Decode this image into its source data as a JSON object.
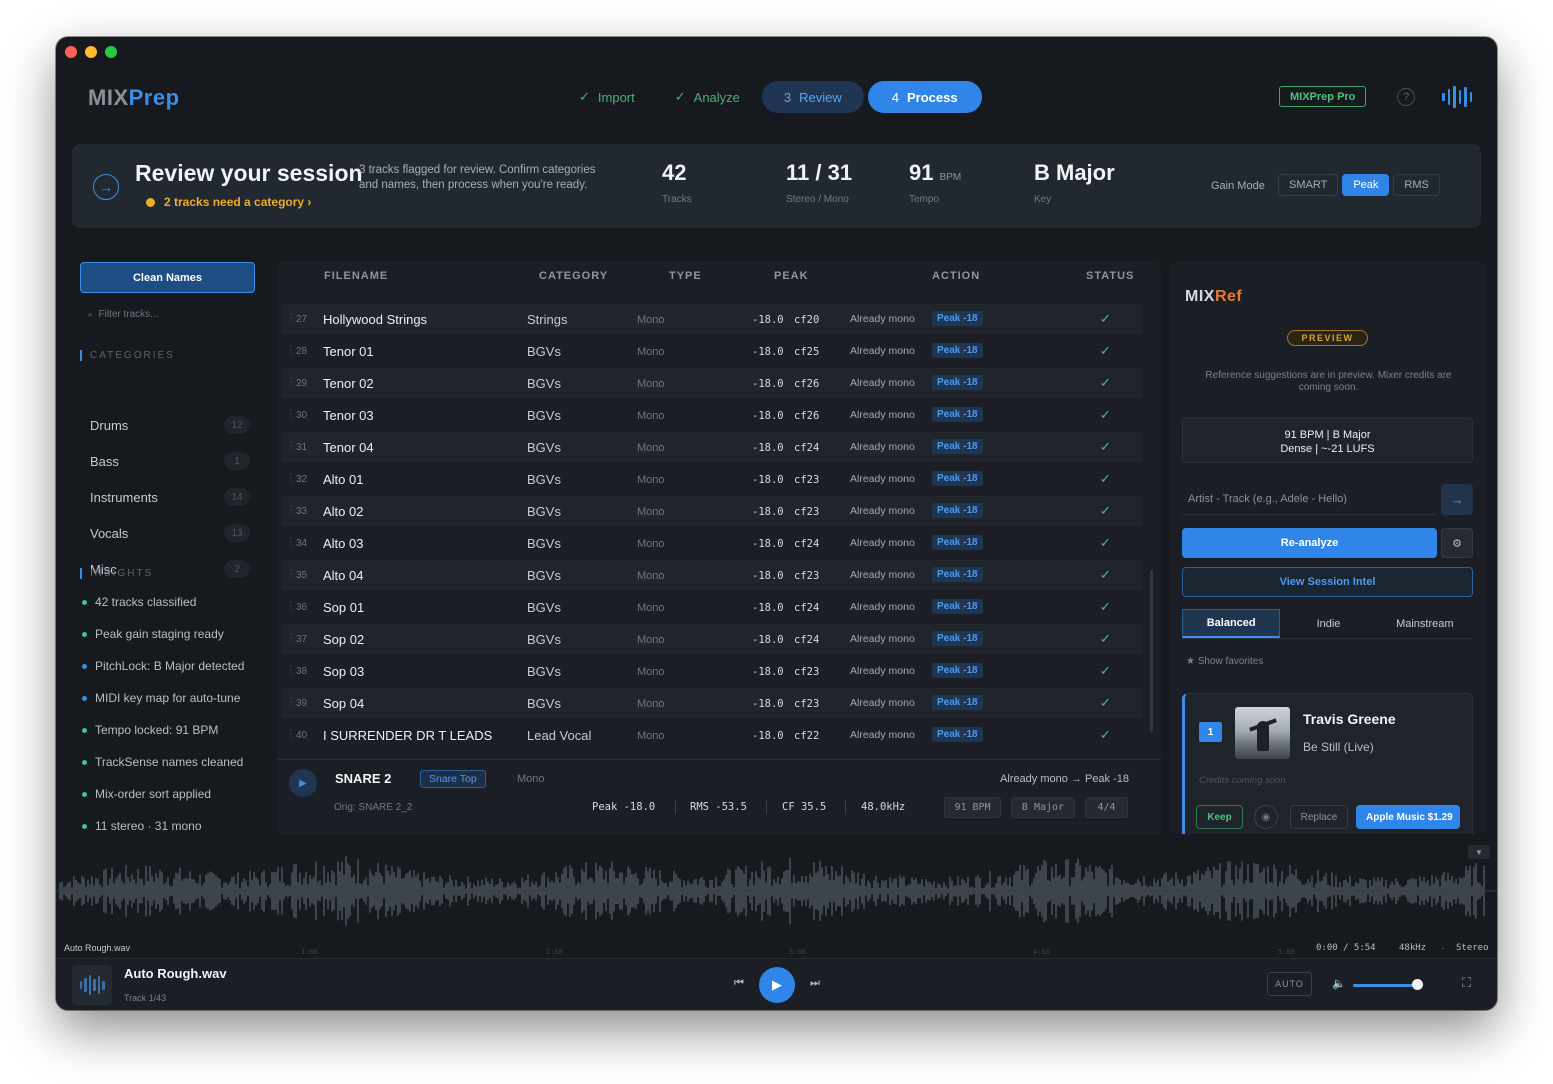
{
  "app": {
    "logo_a": "MIX",
    "logo_b": "Prep"
  },
  "steps": [
    {
      "icon": "✓",
      "label": "Import"
    },
    {
      "icon": "✓",
      "label": "Analyze"
    },
    {
      "icon": "3",
      "label": "Review"
    },
    {
      "icon": "4",
      "label": "Process"
    }
  ],
  "header": {
    "pro_label": "MIXPrep Pro",
    "help": "?"
  },
  "banner": {
    "title": "Review your session",
    "warning": "2 tracks need a category  ›",
    "description": "3 tracks flagged for review. Confirm categories and names, then process when you're ready.",
    "stats": [
      {
        "value": "42",
        "unit": "",
        "label": "Tracks"
      },
      {
        "value": "11 / 31",
        "unit": "",
        "label": "Stereo / Mono"
      },
      {
        "value": "91",
        "unit": "BPM",
        "label": "Tempo"
      },
      {
        "value": "B Major",
        "unit": "",
        "label": "Key"
      }
    ],
    "gain_label": "Gain Mode",
    "gain_modes": [
      "SMART",
      "Peak",
      "RMS"
    ],
    "gain_active": "Peak"
  },
  "sidebar": {
    "clean_label": "Clean Names",
    "filter_placeholder": "Filter tracks...",
    "categories_heading": "CATEGORIES",
    "categories": [
      {
        "name": "Drums",
        "count": "12"
      },
      {
        "name": "Bass",
        "count": "1"
      },
      {
        "name": "Instruments",
        "count": "14"
      },
      {
        "name": "Vocals",
        "count": "13"
      },
      {
        "name": "Misc",
        "count": "2"
      }
    ],
    "insights_heading": "INSIGHTS",
    "insights": [
      {
        "text": "42 tracks classified",
        "color": "#4cc27c"
      },
      {
        "text": "Peak gain staging ready",
        "color": "#4cc27c"
      },
      {
        "text": "PitchLock: B Major detected",
        "color": "#3b8ee8"
      },
      {
        "text": "MIDI key map for auto-tune",
        "color": "#3b8ee8"
      },
      {
        "text": "Tempo locked: 91 BPM",
        "color": "#4cc27c"
      },
      {
        "text": "TrackSense names cleaned",
        "color": "#4cc27c"
      },
      {
        "text": "Mix-order sort applied",
        "color": "#4cc27c"
      },
      {
        "text": "11 stereo · 31 mono",
        "color": "#4cc27c"
      }
    ]
  },
  "table": {
    "headers": [
      "FILENAME",
      "CATEGORY",
      "TYPE",
      "PEAK",
      "ACTION",
      "STATUS"
    ],
    "rows": [
      {
        "num": "27",
        "file": "Hollywood Strings",
        "category": "Strings",
        "type": "Mono",
        "peak": "-18.0",
        "cf": "cf20",
        "action": "Already mono",
        "gain": "Peak -18",
        "status": "✓"
      },
      {
        "num": "28",
        "file": "Tenor 01",
        "category": "BGVs",
        "type": "Mono",
        "peak": "-18.0",
        "cf": "cf25",
        "action": "Already mono",
        "gain": "Peak -18",
        "status": "✓"
      },
      {
        "num": "29",
        "file": "Tenor 02",
        "category": "BGVs",
        "type": "Mono",
        "peak": "-18.0",
        "cf": "cf26",
        "action": "Already mono",
        "gain": "Peak -18",
        "status": "✓"
      },
      {
        "num": "30",
        "file": "Tenor 03",
        "category": "BGVs",
        "type": "Mono",
        "peak": "-18.0",
        "cf": "cf26",
        "action": "Already mono",
        "gain": "Peak -18",
        "status": "✓"
      },
      {
        "num": "31",
        "file": "Tenor 04",
        "category": "BGVs",
        "type": "Mono",
        "peak": "-18.0",
        "cf": "cf24",
        "action": "Already mono",
        "gain": "Peak -18",
        "status": "✓"
      },
      {
        "num": "32",
        "file": "Alto 01",
        "category": "BGVs",
        "type": "Mono",
        "peak": "-18.0",
        "cf": "cf23",
        "action": "Already mono",
        "gain": "Peak -18",
        "status": "✓"
      },
      {
        "num": "33",
        "file": "Alto 02",
        "category": "BGVs",
        "type": "Mono",
        "peak": "-18.0",
        "cf": "cf23",
        "action": "Already mono",
        "gain": "Peak -18",
        "status": "✓"
      },
      {
        "num": "34",
        "file": "Alto 03",
        "category": "BGVs",
        "type": "Mono",
        "peak": "-18.0",
        "cf": "cf24",
        "action": "Already mono",
        "gain": "Peak -18",
        "status": "✓"
      },
      {
        "num": "35",
        "file": "Alto 04",
        "category": "BGVs",
        "type": "Mono",
        "peak": "-18.0",
        "cf": "cf23",
        "action": "Already mono",
        "gain": "Peak -18",
        "status": "✓"
      },
      {
        "num": "36",
        "file": "Sop 01",
        "category": "BGVs",
        "type": "Mono",
        "peak": "-18.0",
        "cf": "cf24",
        "action": "Already mono",
        "gain": "Peak -18",
        "status": "✓"
      },
      {
        "num": "37",
        "file": "Sop 02",
        "category": "BGVs",
        "type": "Mono",
        "peak": "-18.0",
        "cf": "cf24",
        "action": "Already mono",
        "gain": "Peak -18",
        "status": "✓"
      },
      {
        "num": "38",
        "file": "Sop 03",
        "category": "BGVs",
        "type": "Mono",
        "peak": "-18.0",
        "cf": "cf23",
        "action": "Already mono",
        "gain": "Peak -18",
        "status": "✓"
      },
      {
        "num": "39",
        "file": "Sop 04",
        "category": "BGVs",
        "type": "Mono",
        "peak": "-18.0",
        "cf": "cf23",
        "action": "Already mono",
        "gain": "Peak -18",
        "status": "✓"
      },
      {
        "num": "40",
        "file": "I SURRENDER DR T LEADS",
        "category": "Lead Vocal",
        "type": "Mono",
        "peak": "-18.0",
        "cf": "cf22",
        "action": "Already mono",
        "gain": "Peak -18",
        "status": "✓"
      }
    ]
  },
  "detail": {
    "name": "SNARE 2",
    "tag": "Snare Top",
    "type": "Mono",
    "action": "Already mono  →  Peak -18",
    "orig": "Orig: SNARE 2_2",
    "peak": "Peak -18.0",
    "rms": "RMS -53.5",
    "cf": "CF 35.5",
    "rate": "48.0kHz",
    "bpm": "91 BPM",
    "key": "B Major",
    "meter": "4/4"
  },
  "mixref": {
    "logo_a": "MIX",
    "logo_b": "Ref",
    "badge": "PREVIEW",
    "note": "Reference suggestions are in preview. Mixer credits are coming soon.",
    "intel_line1": "91 BPM  |  B Major",
    "intel_line2": "Dense  |  ~-21 LUFS",
    "artist_placeholder": "Artist - Track (e.g., Adele - Hello)",
    "reanalyze": "Re-analyze",
    "view_intel": "View Session Intel",
    "tabs": [
      "Balanced",
      "Indie",
      "Mainstream"
    ],
    "active_tab": "Balanced",
    "favorites": "★ Show favorites",
    "rec": {
      "rank": "1",
      "artist": "Travis Greene",
      "song": "Be Still (Live)",
      "credits": "Credits coming soon",
      "keep": "Keep",
      "replace": "Replace",
      "apple": "Apple Music $1.29"
    }
  },
  "waveform": {
    "file": "Auto Rough.wav",
    "time": "0:00 / 5:54",
    "rate": "48kHz",
    "dot": "·",
    "channels": "Stereo",
    "ticks": [
      "1:00",
      "2:00",
      "3:00",
      "4:00",
      "5:00"
    ]
  },
  "transport": {
    "title": "Auto Rough.wav",
    "sub": "Track 1/43",
    "auto": "AUTO",
    "volume": 0.85
  }
}
